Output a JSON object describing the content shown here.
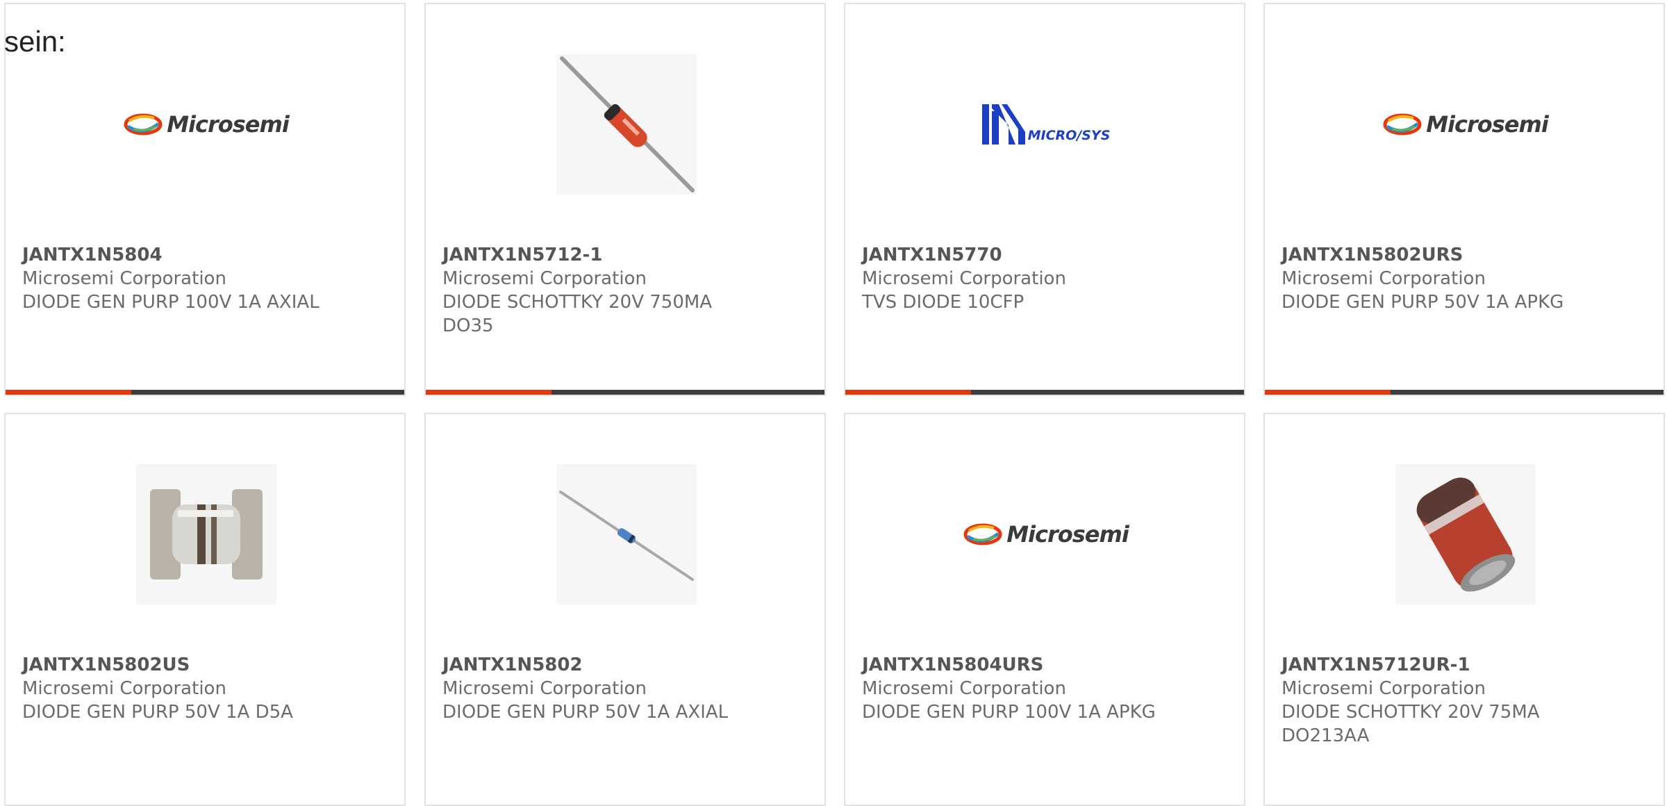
{
  "intro_text": "sein:",
  "brand_colors": {
    "accent": "#e4380c",
    "bar": "#3d3d3d",
    "microsys_blue": "#1d3fc4"
  },
  "products": [
    {
      "part": "JANTX1N5804",
      "manufacturer": "Microsemi Corporation",
      "description": "DIODE GEN PURP 100V 1A AXIAL",
      "image": "microsemi-logo",
      "logo_text": "Microsemi"
    },
    {
      "part": "JANTX1N5712-1",
      "manufacturer": "Microsemi Corporation",
      "description": "DIODE SCHOTTKY 20V 750MA DO35",
      "image": "axial-glass-diode-photo",
      "logo_text": ""
    },
    {
      "part": "JANTX1N5770",
      "manufacturer": "Microsemi Corporation",
      "description": "TVS DIODE 10CFP",
      "image": "microsys-logo",
      "logo_text": "MICRO/SYS"
    },
    {
      "part": "JANTX1N5802URS",
      "manufacturer": "Microsemi Corporation",
      "description": "DIODE GEN PURP 50V 1A APKG",
      "image": "microsemi-logo",
      "logo_text": "Microsemi"
    },
    {
      "part": "JANTX1N5802US",
      "manufacturer": "Microsemi Corporation",
      "description": "DIODE GEN PURP 50V 1A D5A",
      "image": "smd-d5a-diode-photo",
      "logo_text": ""
    },
    {
      "part": "JANTX1N5802",
      "manufacturer": "Microsemi Corporation",
      "description": "DIODE GEN PURP 50V 1A AXIAL",
      "image": "axial-diode-photo",
      "logo_text": ""
    },
    {
      "part": "JANTX1N5804URS",
      "manufacturer": "Microsemi Corporation",
      "description": "DIODE GEN PURP 100V 1A APKG",
      "image": "microsemi-logo",
      "logo_text": "Microsemi"
    },
    {
      "part": "JANTX1N5712UR-1",
      "manufacturer": "Microsemi Corporation",
      "description": "DIODE SCHOTTKY 20V 75MA DO213AA",
      "image": "melf-diode-photo",
      "logo_text": ""
    }
  ]
}
